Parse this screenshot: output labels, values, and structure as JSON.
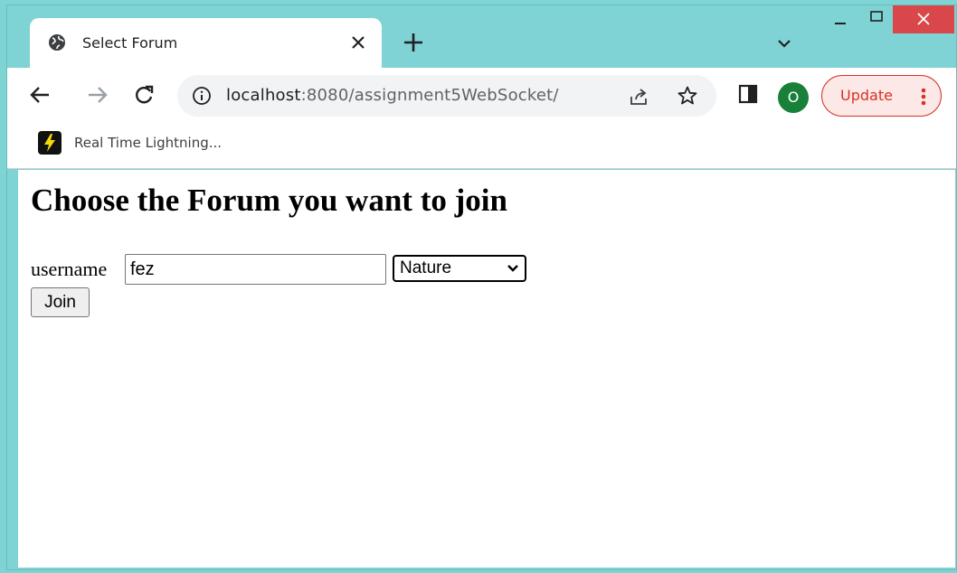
{
  "tab": {
    "title": "Select Forum"
  },
  "address_bar": {
    "host": "localhost",
    "path": ":8080/assignment5WebSocket/"
  },
  "profile": {
    "initial": "O"
  },
  "update_button": {
    "label": "Update"
  },
  "bookmarks": [
    {
      "label": "Real Time Lightning..."
    }
  ],
  "page": {
    "heading": "Choose the Forum you want to join",
    "username_label": "username",
    "username_value": "fez",
    "forum_selected": "Nature",
    "join_label": "Join"
  },
  "colors": {
    "frame": "#7fd3d4",
    "close_button": "#d9474b",
    "profile_bg": "#188038",
    "update_accent": "#d93025"
  }
}
